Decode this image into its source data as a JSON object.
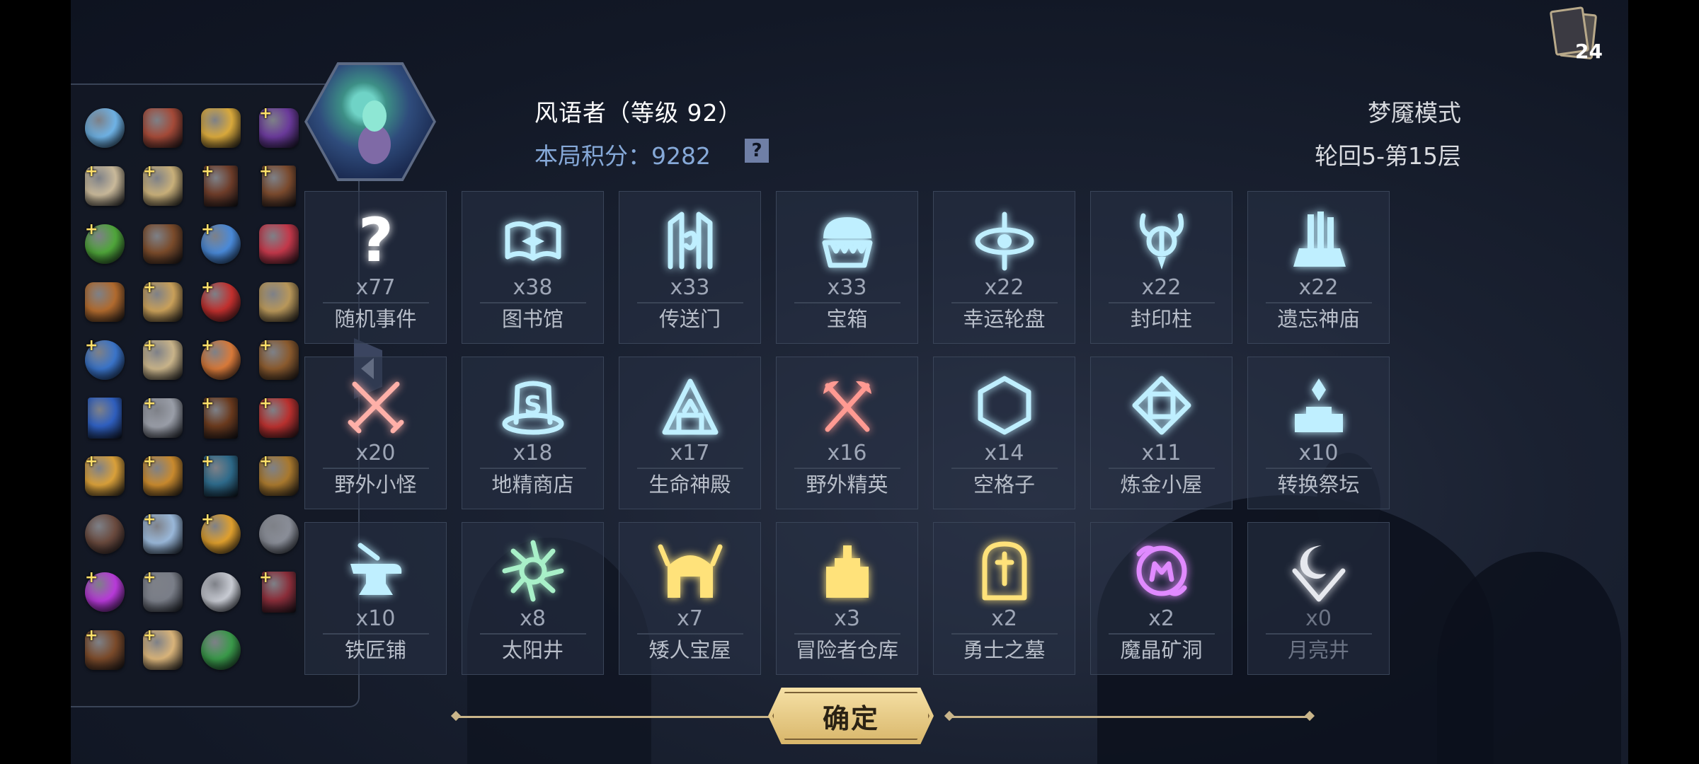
{
  "card_counter": {
    "count": "24",
    "icon": "card-deck-icon"
  },
  "hero": {
    "name_line": "风语者（等级 92）",
    "score_line": "本局积分：9282",
    "score_help": "?",
    "mode": "梦魇模式",
    "floor": "轮回5-第15层"
  },
  "inventory": {
    "items": [
      {
        "icon": "clam-shell-icon",
        "plus": false,
        "color": "#6fb3e6"
      },
      {
        "icon": "meat-icon",
        "plus": false,
        "color": "#a44a38"
      },
      {
        "icon": "golden-key-icon",
        "plus": false,
        "color": "#d9a93c"
      },
      {
        "icon": "witch-hat-icon",
        "plus": true,
        "color": "#6a3a9a"
      },
      {
        "icon": "beast-skull-icon",
        "plus": true,
        "color": "#c9b99a"
      },
      {
        "icon": "scarecrow-icon",
        "plus": true,
        "color": "#c9b07a"
      },
      {
        "icon": "brown-tome-icon",
        "plus": true,
        "color": "#6e3d2a"
      },
      {
        "icon": "leather-book-icon",
        "plus": true,
        "color": "#7a4a2e"
      },
      {
        "icon": "green-potion-icon",
        "plus": true,
        "color": "#4fa63a"
      },
      {
        "icon": "backpack-icon",
        "plus": false,
        "color": "#7a4b2b"
      },
      {
        "icon": "pinwheel-icon",
        "plus": true,
        "color": "#4a8ad9"
      },
      {
        "icon": "coral-icon",
        "plus": false,
        "color": "#c2384a"
      },
      {
        "icon": "treasure-chest-icon",
        "plus": false,
        "color": "#b06a2e"
      },
      {
        "icon": "map-scroll-icon",
        "plus": true,
        "color": "#c9a05a"
      },
      {
        "icon": "red-potion-icon",
        "plus": true,
        "color": "#c2302e"
      },
      {
        "icon": "parchment-icon",
        "plus": false,
        "color": "#b8975a"
      },
      {
        "icon": "blue-flask-icon",
        "plus": true,
        "color": "#3a74c9"
      },
      {
        "icon": "old-scroll-icon",
        "plus": true,
        "color": "#c9b48a"
      },
      {
        "icon": "conch-shell-icon",
        "plus": true,
        "color": "#d97a3a"
      },
      {
        "icon": "slingshot-icon",
        "plus": true,
        "color": "#8a5a2e"
      },
      {
        "icon": "mystery-card-icon",
        "plus": false,
        "color": "#2f5fbf"
      },
      {
        "icon": "rune-stone-icon",
        "plus": true,
        "color": "#9a9ea8"
      },
      {
        "icon": "spellbook-icon",
        "plus": true,
        "color": "#6a3a1e"
      },
      {
        "icon": "red-claw-icon",
        "plus": true,
        "color": "#b8302e"
      },
      {
        "icon": "alchemy-set-icon",
        "plus": true,
        "color": "#d9a03a"
      },
      {
        "icon": "leather-glove-icon",
        "plus": true,
        "color": "#c98a2e"
      },
      {
        "icon": "blue-tablet-icon",
        "plus": true,
        "color": "#2e6a8a"
      },
      {
        "icon": "balance-scale-icon",
        "plus": true,
        "color": "#a8782e"
      },
      {
        "icon": "rock-icon",
        "plus": false,
        "color": "#6a4a3e"
      },
      {
        "icon": "silver-chest-icon",
        "plus": true,
        "color": "#9ab8d9"
      },
      {
        "icon": "starfish-icon",
        "plus": true,
        "color": "#e0a02e"
      },
      {
        "icon": "spiked-collar-icon",
        "plus": false,
        "color": "#8a8e98"
      },
      {
        "icon": "purple-potion-icon",
        "plus": true,
        "color": "#b83ad9"
      },
      {
        "icon": "stone-pile-icon",
        "plus": true,
        "color": "#7a7e88"
      },
      {
        "icon": "amulet-icon",
        "plus": false,
        "color": "#c9ccd4"
      },
      {
        "icon": "red-grimoire-icon",
        "plus": true,
        "color": "#8a2e3a"
      },
      {
        "icon": "wooden-crate-icon",
        "plus": true,
        "color": "#7a4a2a"
      },
      {
        "icon": "rolled-scroll-icon",
        "plus": true,
        "color": "#d9b47a"
      },
      {
        "icon": "green-bowl-icon",
        "plus": false,
        "color": "#3a9a4a"
      }
    ]
  },
  "events": [
    {
      "icon": "question-mark-icon",
      "count": "x77",
      "name": "随机事件",
      "color": "#ffffff",
      "dim": false
    },
    {
      "icon": "open-book-icon",
      "count": "x38",
      "name": "图书馆",
      "color": "#bfefff",
      "dim": false
    },
    {
      "icon": "portal-gate-icon",
      "count": "x33",
      "name": "传送门",
      "color": "#bfefff",
      "dim": false
    },
    {
      "icon": "chest-monster-icon",
      "count": "x33",
      "name": "宝箱",
      "color": "#bfefff",
      "dim": false
    },
    {
      "icon": "fortune-wheel-icon",
      "count": "x22",
      "name": "幸运轮盘",
      "color": "#bfefff",
      "dim": false
    },
    {
      "icon": "seal-pillar-icon",
      "count": "x22",
      "name": "封印柱",
      "color": "#bfefff",
      "dim": false
    },
    {
      "icon": "forgotten-temple-icon",
      "count": "x22",
      "name": "遗忘神庙",
      "color": "#bfefff",
      "dim": false
    },
    {
      "icon": "crossed-swords-icon",
      "count": "x20",
      "name": "野外小怪",
      "color": "#ffb0a8",
      "dim": false
    },
    {
      "icon": "gnome-hat-icon",
      "count": "x18",
      "name": "地精商店",
      "color": "#bfefff",
      "dim": false
    },
    {
      "icon": "life-shrine-icon",
      "count": "x17",
      "name": "生命神殿",
      "color": "#bfefff",
      "dim": false
    },
    {
      "icon": "crossed-axes-icon",
      "count": "x16",
      "name": "野外精英",
      "color": "#ff9a92",
      "dim": false
    },
    {
      "icon": "hexagon-slot-icon",
      "count": "x14",
      "name": "空格子",
      "color": "#bfefff",
      "dim": false
    },
    {
      "icon": "alchemy-hut-icon",
      "count": "x11",
      "name": "炼金小屋",
      "color": "#bfefff",
      "dim": false
    },
    {
      "icon": "conversion-altar-icon",
      "count": "x10",
      "name": "转换祭坛",
      "color": "#bfefff",
      "dim": false
    },
    {
      "icon": "anvil-icon",
      "count": "x10",
      "name": "铁匠铺",
      "color": "#bfefff",
      "dim": false
    },
    {
      "icon": "sun-well-icon",
      "count": "x8",
      "name": "太阳井",
      "color": "#a8f0c8",
      "dim": false
    },
    {
      "icon": "dwarf-helm-icon",
      "count": "x7",
      "name": "矮人宝屋",
      "color": "#ffe27a",
      "dim": false
    },
    {
      "icon": "castle-warehouse-icon",
      "count": "x3",
      "name": "冒险者仓库",
      "color": "#ffe27a",
      "dim": false
    },
    {
      "icon": "tombstone-icon",
      "count": "x2",
      "name": "勇士之墓",
      "color": "#ffe27a",
      "dim": false
    },
    {
      "icon": "crystal-mine-icon",
      "count": "x2",
      "name": "魔晶矿洞",
      "color": "#e08aff",
      "dim": false
    },
    {
      "icon": "moon-well-icon",
      "count": "x0",
      "name": "月亮井",
      "color": "#e6e8ee",
      "dim": true
    }
  ],
  "confirm": {
    "label": "确定"
  }
}
